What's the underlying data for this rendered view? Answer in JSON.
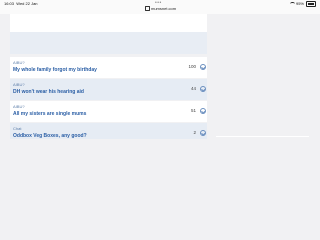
{
  "status_bar": {
    "time": "16:03",
    "date": "Wed 22 Jan",
    "url": "mumsnet.com",
    "battery": "95%"
  },
  "threads": [
    {
      "category": "AIBU?",
      "title": "My whole family forgot my birthday",
      "count": "100"
    },
    {
      "category": "AIBU?",
      "title": "DH won't wear his hearing aid",
      "count": "44"
    },
    {
      "category": "AIBU?",
      "title": "All my sisters are single mums",
      "count": "51"
    },
    {
      "category": "Chat",
      "title": "Oddbox Veg Boxes, any good?",
      "count": "2"
    }
  ]
}
